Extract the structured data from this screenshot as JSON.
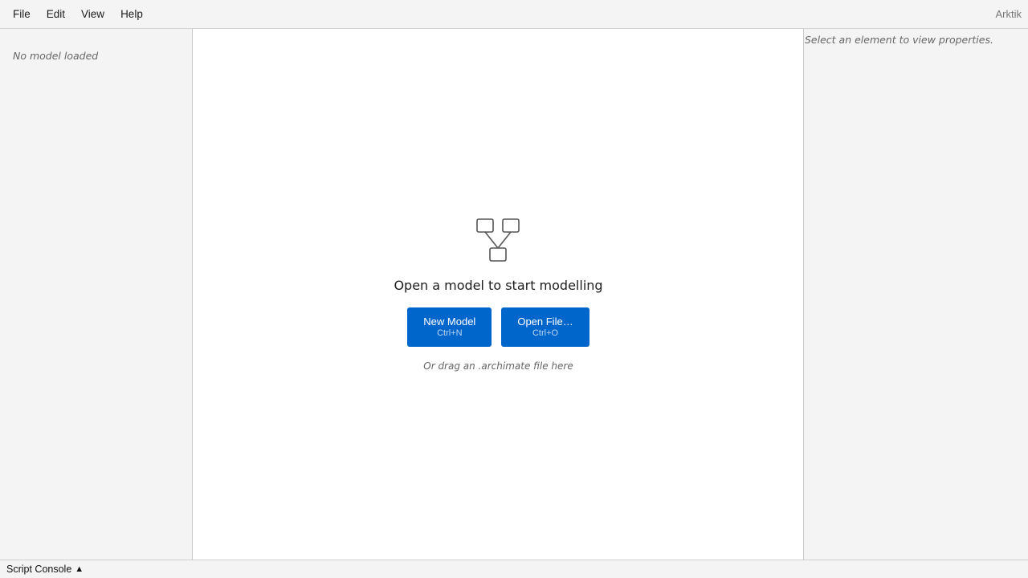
{
  "menubar": {
    "items": [
      "File",
      "Edit",
      "View",
      "Help"
    ],
    "app_name": "Arktik"
  },
  "model_tree": {
    "empty_text": "No model loaded"
  },
  "canvas": {
    "icon": "model-diagram-icon",
    "title": "Open a model to start modelling",
    "buttons": [
      {
        "label": "New Model",
        "shortcut": "Ctrl+N"
      },
      {
        "label": "Open File…",
        "shortcut": "Ctrl+O"
      }
    ],
    "drag_hint": "Or drag an .archimate file here"
  },
  "properties": {
    "empty_text": "Select an element to view properties."
  },
  "statusbar": {
    "console_label": "Script Console",
    "console_caret": "▲"
  },
  "colors": {
    "accent": "#0066cc",
    "panel_bg": "#f4f4f4",
    "canvas_bg": "#ffffff"
  }
}
